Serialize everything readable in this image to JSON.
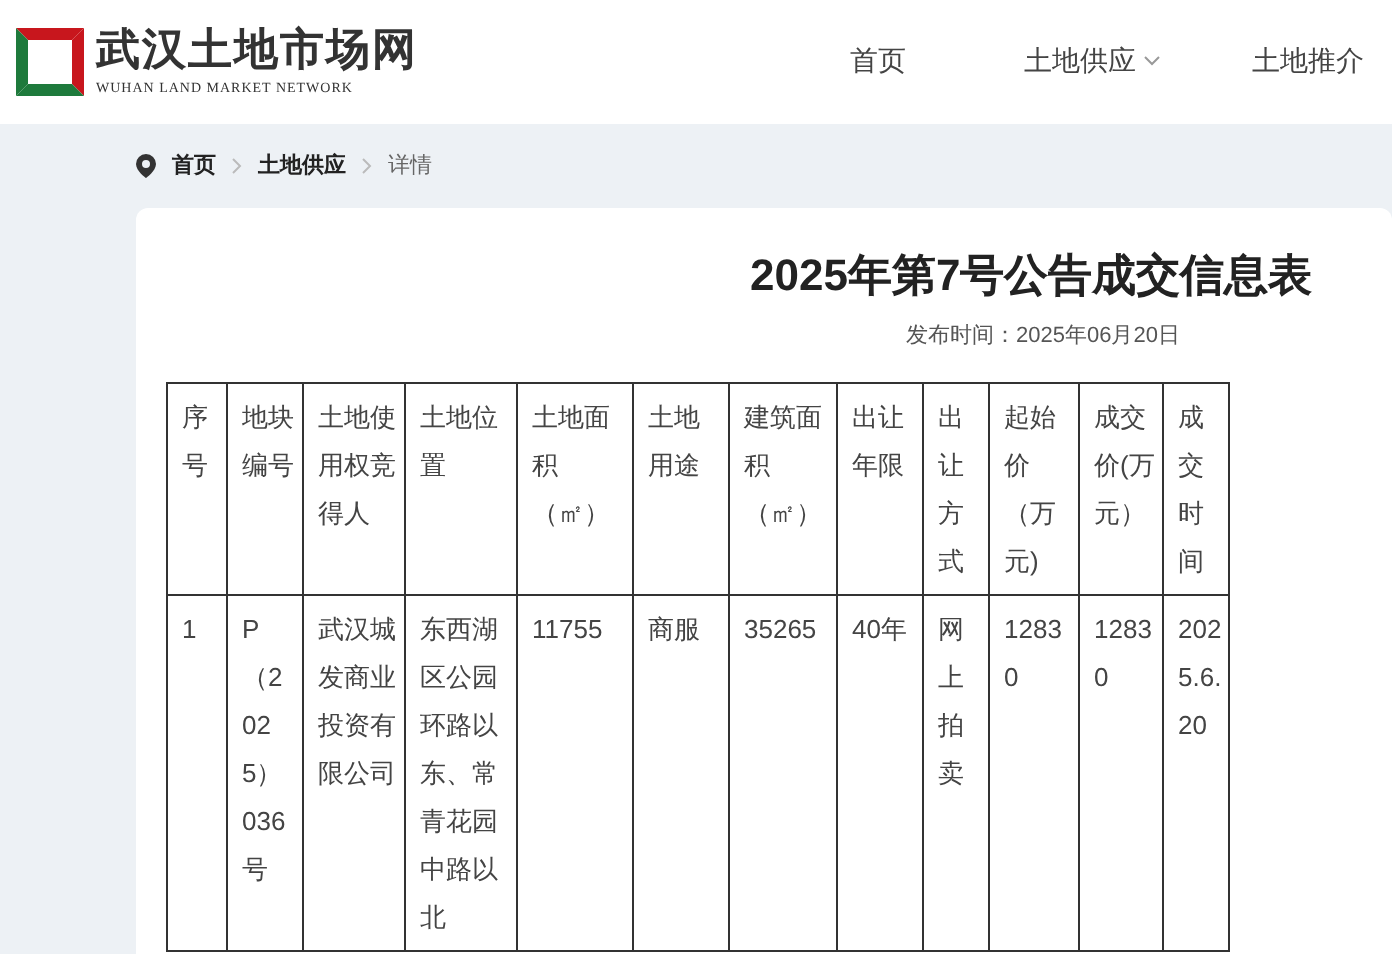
{
  "logo": {
    "title": "武汉土地市场网",
    "subtitle": "WUHAN LAND MARKET NETWORK"
  },
  "nav": [
    {
      "label": "首页",
      "dropdown": false
    },
    {
      "label": "土地供应",
      "dropdown": true
    },
    {
      "label": "土地推介",
      "dropdown": false
    }
  ],
  "breadcrumb": [
    "首页",
    "土地供应",
    "详情"
  ],
  "article": {
    "title": "2025年第7号公告成交信息表",
    "published": "发布时间：2025年06月20日"
  },
  "table": {
    "columns": [
      "序号",
      "地块编号",
      "土地使用权竞得人",
      "土地位置",
      "土地面积（㎡）",
      "土地用途",
      "建筑面积（㎡）",
      "出让年限",
      "出让方式",
      "起始价（万元)",
      "成交价(万元）",
      "成交时间"
    ],
    "rows": [
      [
        "1",
        "P（2025）036号",
        "武汉城发商业投资有限公司",
        "东西湖区公园环路以东、常青花园中路以北",
        "11755",
        "商服",
        "35265",
        "40年",
        "网上拍卖",
        "12830",
        "12830",
        "2025.6.20"
      ]
    ]
  }
}
